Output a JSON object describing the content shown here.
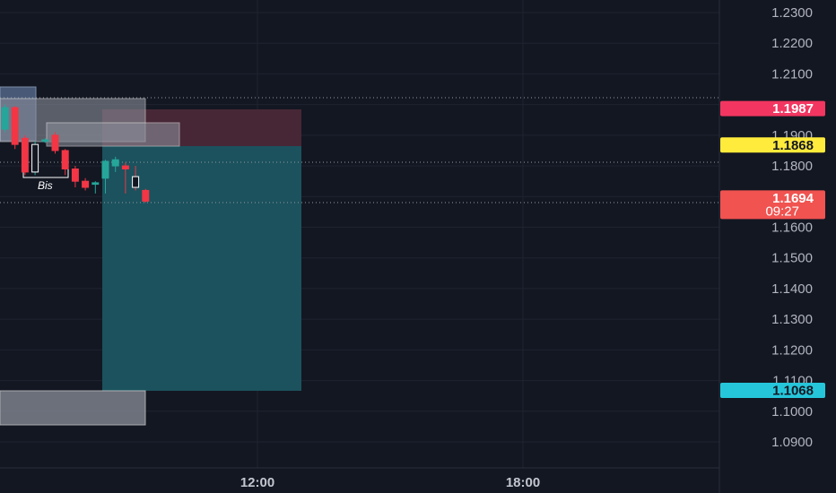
{
  "chart_data": {
    "type": "candlestick",
    "price_axis": {
      "ticks": [
        "1.2300",
        "1.2200",
        "1.2100",
        "1.1900",
        "1.1800",
        "1.1600",
        "1.1500",
        "1.1400",
        "1.1300",
        "1.1200",
        "1.1100",
        "1.1000",
        "1.0900"
      ],
      "ylim": [
        1.0835,
        1.2335
      ]
    },
    "time_axis": {
      "ticks": [
        "12:00",
        "18:00"
      ]
    },
    "price_labels": [
      {
        "name": "level-1987",
        "value": "1.1987",
        "price": 1.1987,
        "color": "#f23661",
        "text_color": "#ffffff"
      },
      {
        "name": "level-1868",
        "value": "1.1868",
        "price": 1.1868,
        "color": "#ffeb3b",
        "text_color": "#131722"
      },
      {
        "name": "last-price",
        "value": "1.1694",
        "sub": "09:27",
        "price": 1.1694,
        "color": "#f05350",
        "text_color": "#ffffff"
      },
      {
        "name": "level-1068",
        "value": "1.1068",
        "price": 1.1068,
        "color": "#26c6da",
        "text_color": "#131722"
      }
    ],
    "annotations": [
      "Bis"
    ],
    "candles": [
      {
        "o": 1.199,
        "h": 1.2,
        "l": 1.191,
        "c": 1.192,
        "dir": "up"
      },
      {
        "o": 1.199,
        "h": 1.1995,
        "l": 1.1855,
        "c": 1.187,
        "dir": "down"
      },
      {
        "o": 1.189,
        "h": 1.19,
        "l": 1.177,
        "c": 1.178,
        "dir": "down"
      },
      {
        "o": 1.178,
        "h": 1.188,
        "l": 1.177,
        "c": 1.187,
        "dir": "up"
      },
      {
        "o": 1.188,
        "h": 1.189,
        "l": 1.1875,
        "c": 1.1885,
        "dir": "up"
      },
      {
        "o": 1.19,
        "h": 1.191,
        "l": 1.184,
        "c": 1.185,
        "dir": "down"
      },
      {
        "o": 1.185,
        "h": 1.1855,
        "l": 1.177,
        "c": 1.179,
        "dir": "down"
      },
      {
        "o": 1.179,
        "h": 1.18,
        "l": 1.173,
        "c": 1.175,
        "dir": "down"
      },
      {
        "o": 1.175,
        "h": 1.176,
        "l": 1.172,
        "c": 1.173,
        "dir": "down"
      },
      {
        "o": 1.174,
        "h": 1.175,
        "l": 1.171,
        "c": 1.1745,
        "dir": "up"
      },
      {
        "o": 1.176,
        "h": 1.182,
        "l": 1.171,
        "c": 1.1815,
        "dir": "up"
      },
      {
        "o": 1.18,
        "h": 1.183,
        "l": 1.178,
        "c": 1.182,
        "dir": "up"
      },
      {
        "o": 1.18,
        "h": 1.181,
        "l": 1.171,
        "c": 1.179,
        "dir": "down"
      },
      {
        "o": 1.1765,
        "h": 1.18,
        "l": 1.172,
        "c": 1.173,
        "dir": "down"
      },
      {
        "o": 1.172,
        "h": 1.1725,
        "l": 1.168,
        "c": 1.1685,
        "dir": "down"
      }
    ]
  },
  "colors": {
    "background": "#131722",
    "grid": "#1f2330",
    "up": "#26a69a",
    "down": "#f23645",
    "take_profit": "#1e6b77",
    "stop_loss": "#5c2a3a"
  }
}
